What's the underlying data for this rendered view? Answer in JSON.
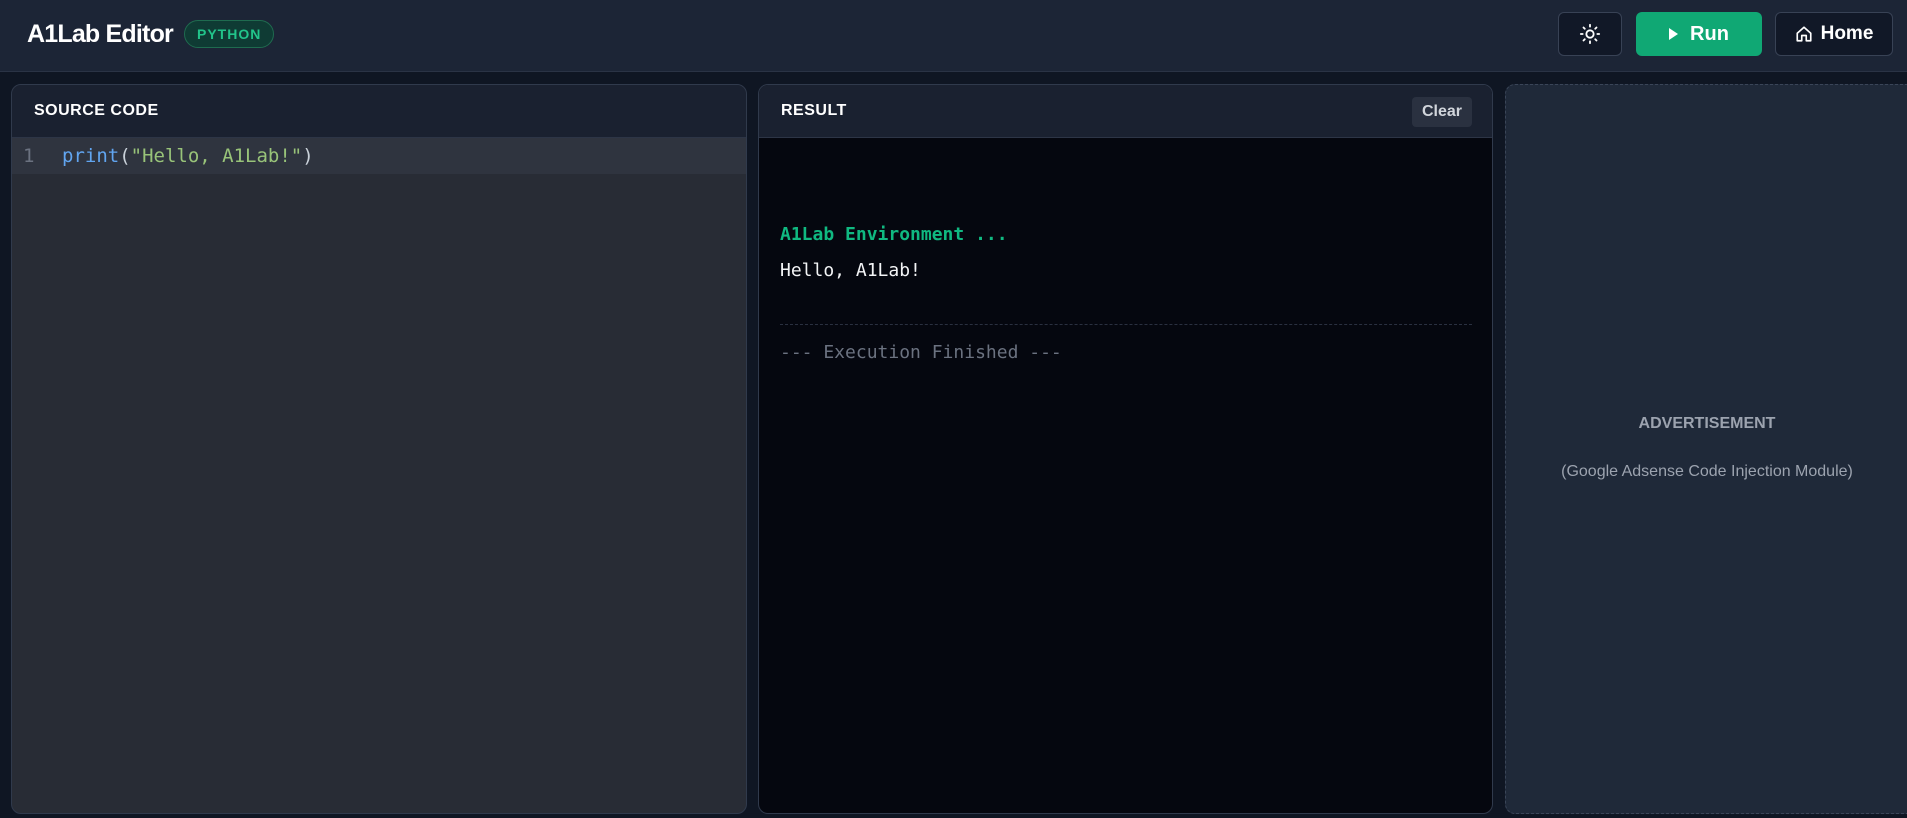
{
  "header": {
    "brand": "A1Lab Editor",
    "language_badge": "PYTHON",
    "theme_icon": "sun-icon",
    "run_label": "Run",
    "home_label": "Home",
    "accent_color": "#10a874"
  },
  "source": {
    "title": "SOURCE CODE",
    "lines": [
      {
        "number": "1",
        "fn": "print",
        "open": "(",
        "string": "\"Hello, A1Lab!\"",
        "close": ")"
      }
    ]
  },
  "result": {
    "title": "RESULT",
    "clear_label": "Clear",
    "env_line": "A1Lab Environment ...",
    "output_line": "Hello, A1Lab!",
    "finish_line": "--- Execution Finished ---"
  },
  "ad": {
    "title": "ADVERTISEMENT",
    "subtitle": "(Google Adsense Code Injection Module)"
  }
}
